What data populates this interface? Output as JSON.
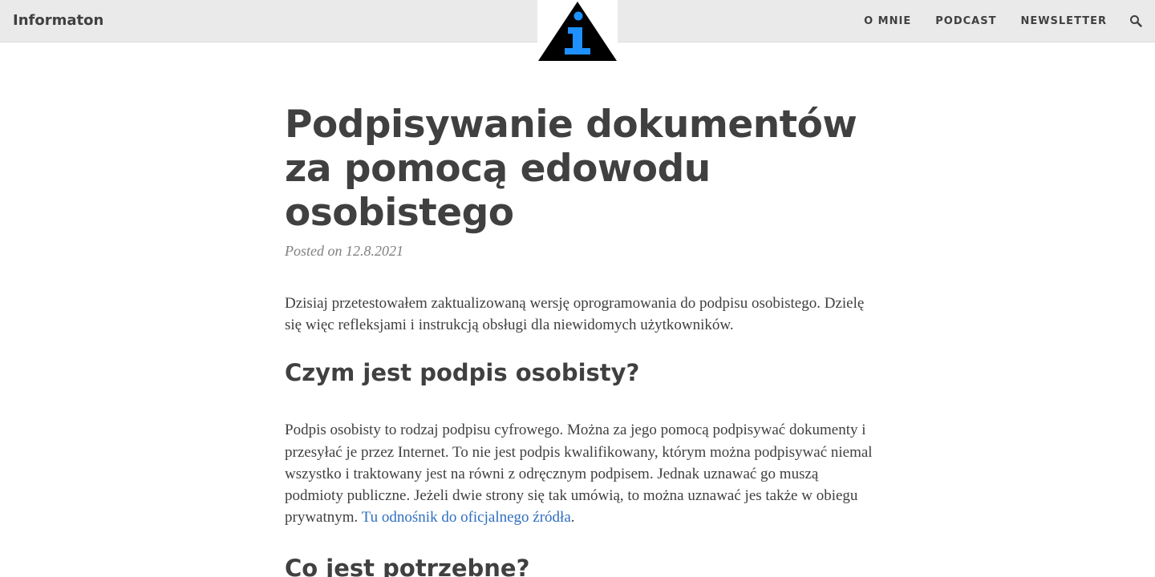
{
  "nav": {
    "brand": "Informaton",
    "links": [
      "O MNIE",
      "PODCAST",
      "NEWSLETTER"
    ],
    "search_icon": "search-icon",
    "logo_icon": "info-triangle-icon"
  },
  "colors": {
    "navbar_bg": "#eaeaea",
    "text": "#404040",
    "meta": "#808080",
    "link": "#2f6fc0",
    "logo_accent": "#1e90ff"
  },
  "post": {
    "title": "Podpisywanie dokumentów za pomocą edowodu osobistego",
    "meta": "Posted on 12.8.2021",
    "intro": "Dzisiaj przetestowałem zaktualizowaną wersję oprogramowania do podpisu osobistego. Dzielę się więc refleksjami i instrukcją obsługi dla niewidomych użytkowników.",
    "section1": {
      "heading": "Czym jest podpis osobisty?",
      "body": "Podpis osobisty to rodzaj podpisu cyfrowego. Można za jego pomocą podpisywać dokumenty i przesyłać je przez Internet. To nie jest podpis kwalifikowany, którym można podpisywać niemal wszystko i traktowany jest na równi z odręcznym podpisem. Jednak uznawać go muszą podmioty publiczne. Jeżeli dwie strony się tak umówią, to można uznawać jes także w obiegu prywatnym.",
      "link_text": "Tu odnośnik do oficjalnego źródła",
      "trailing": "."
    },
    "section2": {
      "heading": "Co jest potrzebne?"
    }
  }
}
